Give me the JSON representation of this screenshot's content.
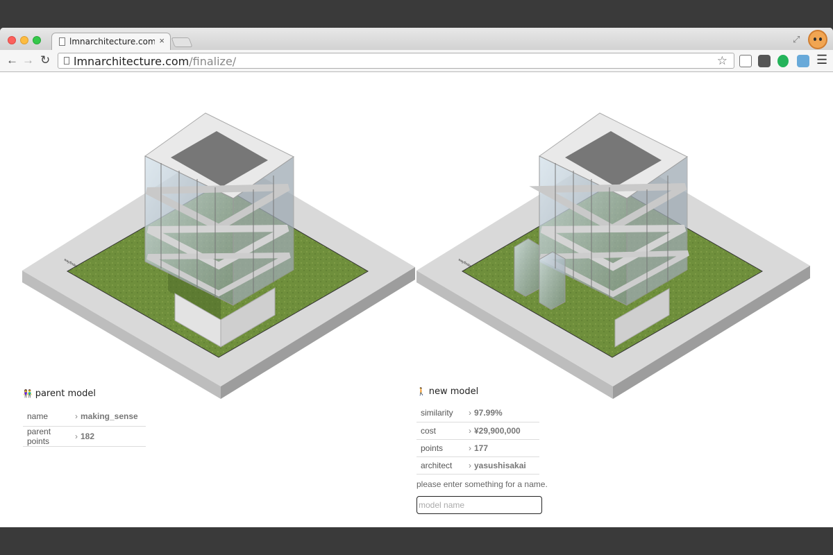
{
  "browser": {
    "tab_title": "lmnarchitecture.com/finali",
    "url_domain": "lmnarchitecture.com",
    "url_path": "/finalize/"
  },
  "colors": {
    "concrete": "#d8d8d8",
    "grass": "#6f8f3c",
    "glass": "#b8c6d1",
    "panel_text": "#555555"
  },
  "icons": {
    "back": "back-arrow-icon",
    "forward": "forward-arrow-icon",
    "reload": "reload-icon",
    "bookmark": "star-icon",
    "menu": "hamburger-menu-icon"
  },
  "parent_model": {
    "title": "parent model",
    "rows": [
      {
        "label": "name",
        "value": "making_sense"
      },
      {
        "label": "parent points",
        "value": "182"
      }
    ]
  },
  "new_model": {
    "title": "new model",
    "rows": [
      {
        "label": "similarity",
        "value": "97.99%"
      },
      {
        "label": "cost",
        "value": "¥29,900,000"
      },
      {
        "label": "points",
        "value": "177"
      },
      {
        "label": "architect",
        "value": "yasushisakai"
      }
    ],
    "hint": "please enter something for a name.",
    "input_placeholder": "model name"
  }
}
